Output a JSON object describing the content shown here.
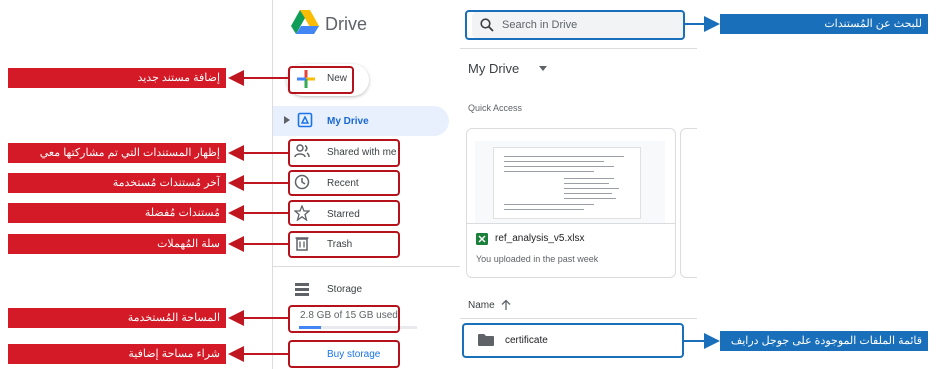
{
  "app": {
    "name": "Drive",
    "new_label": "New",
    "search_placeholder": "Search in Drive"
  },
  "sidebar": {
    "items": [
      {
        "label": "My Drive",
        "icon": "my-drive-icon",
        "active": true
      },
      {
        "label": "Shared with me",
        "icon": "shared-icon"
      },
      {
        "label": "Recent",
        "icon": "clock-icon"
      },
      {
        "label": "Starred",
        "icon": "star-icon"
      },
      {
        "label": "Trash",
        "icon": "trash-icon"
      }
    ],
    "storage_label": "Storage",
    "storage_used": "2.8 GB of 15 GB used",
    "storage_fraction": 0.19,
    "buy_storage": "Buy storage"
  },
  "main": {
    "title": "My Drive",
    "quick_access": "Quick Access",
    "file": {
      "name": "ref_analysis_v5.xlsx",
      "subtitle": "You uploaded in the past week"
    },
    "sort_label": "Name",
    "folder": "certificate"
  },
  "callouts": {
    "new": "إضافة مستند جديد",
    "shared": "إظهار المستندات التي تم مشاركتها معي",
    "recent": "آخر مُستندات مُستخدمة",
    "starred": "مُستندات مُفضلة",
    "trash": "سلة المُهملات",
    "storage": "المساحة المُستخدمة",
    "buy": "شراء مساحة إضافية",
    "search": "للبحث عن المُستندات",
    "files": "قائمة الملفات الموجودة على جوجل درايف"
  },
  "colors": {
    "callout_red": "#d31a26",
    "callout_blue": "#1a6fba",
    "active_nav": "#e8f0fe",
    "link_blue": "#1a73e8"
  }
}
